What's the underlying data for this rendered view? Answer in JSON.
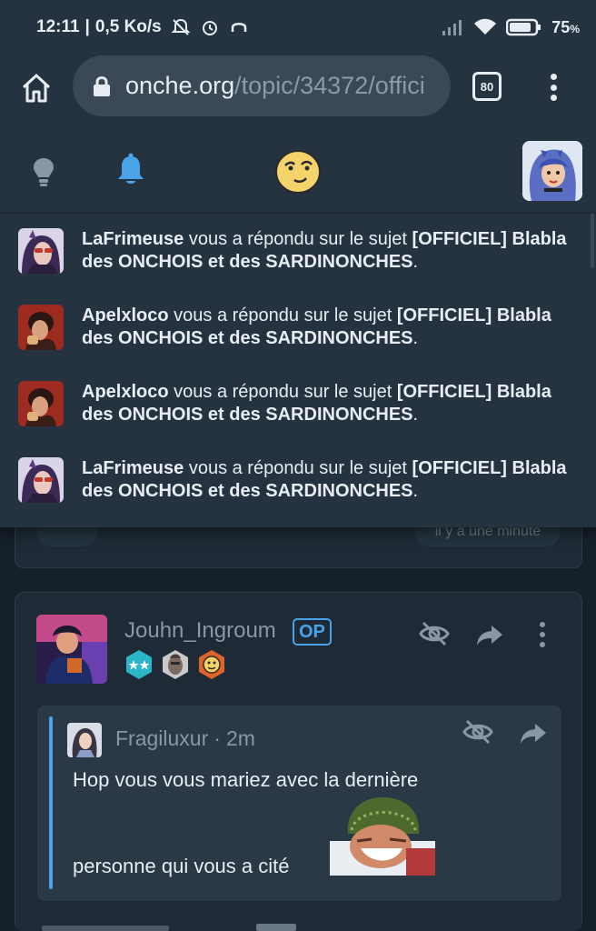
{
  "status_bar": {
    "time": "12:11",
    "network_speed": "0,5 Ko/s",
    "battery": "75",
    "battery_unit": "%"
  },
  "browser": {
    "url_domain": "onche.org",
    "url_path": "/topic/34372/offici",
    "tab_count": "80"
  },
  "notifications": [
    {
      "user": "LaFrimeuse",
      "text": " vous a répondu sur le sujet ",
      "topic": "[OFFICIEL] Blabla des ONCHOIS et des SARDINONCHES",
      "end": ".",
      "avatar": "purple"
    },
    {
      "user": "Apelxloco",
      "text": " vous a répondu sur le sujet ",
      "topic": "[OFFICIEL] Blabla des ONCHOIS et des SARDINONCHES",
      "end": ".",
      "avatar": "red"
    },
    {
      "user": "Apelxloco",
      "text": " vous a répondu sur le sujet ",
      "topic": "[OFFICIEL] Blabla des ONCHOIS et des SARDINONCHES",
      "end": ".",
      "avatar": "red"
    },
    {
      "user": "LaFrimeuse",
      "text": " vous a répondu sur le sujet ",
      "topic": "[OFFICIEL] Blabla des ONCHOIS et des SARDINONCHES",
      "end": ".",
      "avatar": "purple"
    }
  ],
  "previous_card": {
    "timestamp": "il y a une minute"
  },
  "post": {
    "author": "Jouhn_Ingroum",
    "op_badge": "OP",
    "quote": {
      "author": "Fragiluxur",
      "separator": "·",
      "time": "2m",
      "line1": "Hop vous vous mariez avec la dernière",
      "line2": "personne qui vous a cité"
    }
  },
  "colors": {
    "background": "#15202b",
    "panel": "#253341",
    "accent": "#4aa3e8"
  }
}
